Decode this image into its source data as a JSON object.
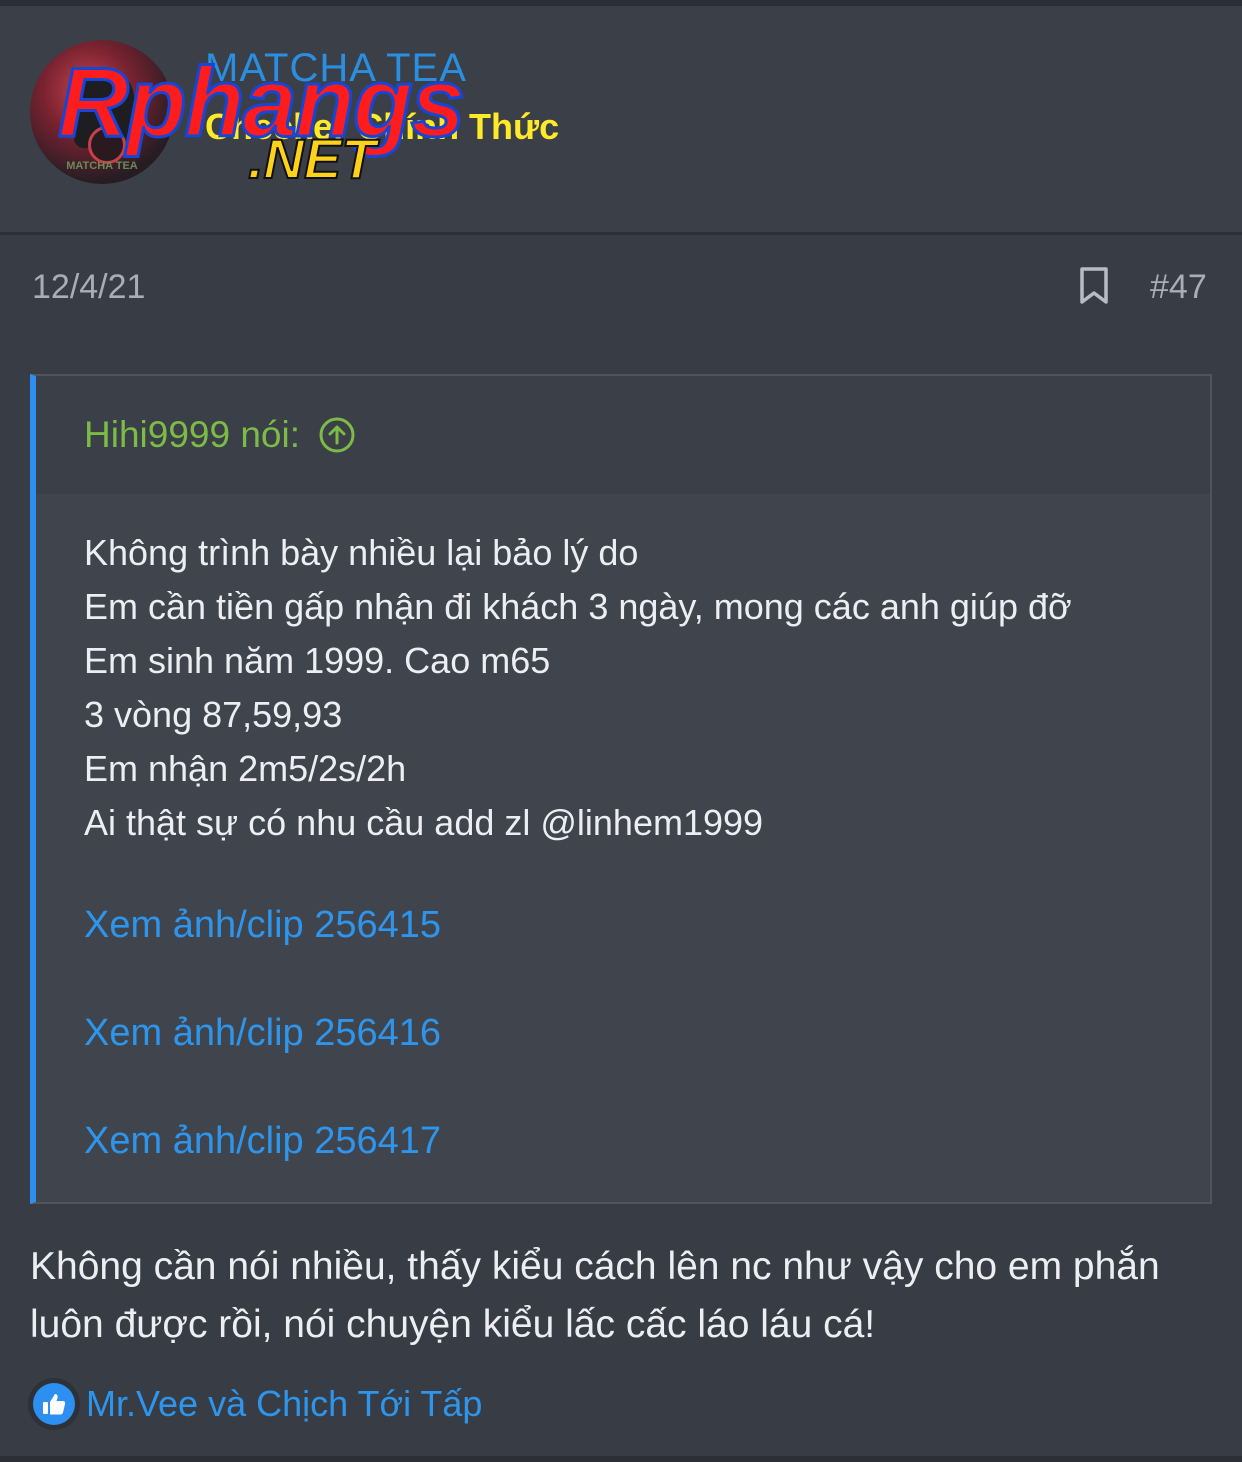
{
  "post": {
    "author": "MATCHA TEA",
    "author_title": "Checker Chính Thức",
    "avatar_caption": "MATCHA TEA",
    "watermark": {
      "line1": "Rphangs",
      "line2": ".NET"
    },
    "date": "12/4/21",
    "number": "#47",
    "bookmark_icon": "bookmark-icon"
  },
  "quote": {
    "author_label": "Hihi9999 nói:",
    "jump_icon": "arrow-up-circle-icon",
    "lines": [
      "Không trình bày nhiều lại bảo lý do",
      "Em cần tiền gấp nhận đi khách 3 ngày, mong các anh giúp đỡ",
      "Em sinh năm 1999. Cao m65",
      "3 vòng 87,59,93",
      "Em nhận 2m5/2s/2h",
      "Ai thật sự có nhu cầu add zl @linhem1999"
    ],
    "media_links": [
      "Xem ảnh/clip 256415",
      "Xem ảnh/clip 256416",
      "Xem ảnh/clip 256417"
    ]
  },
  "reply": {
    "text": "Không cần nói nhiều, thấy kiểu cách lên nc như vậy cho em phắn luôn được rồi, nói chuyện kiểu lấc cấc láo láu cá!"
  },
  "reactions": {
    "icon": "thumbs-up-icon",
    "text": "Mr.Vee và Chịch Tới Tấp"
  },
  "colors": {
    "background": "#383c45",
    "accent_blue": "#2d8ff0",
    "quote_author_green": "#7dbb47",
    "title_yellow": "#ffea2a"
  }
}
